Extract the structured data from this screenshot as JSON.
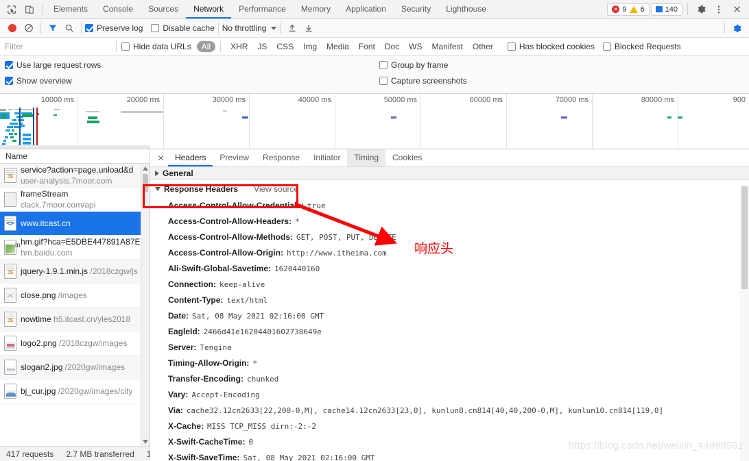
{
  "topbar": {
    "icons": [
      "inspect-element-icon",
      "device-toolbar-icon"
    ],
    "tabs": [
      {
        "label": "Elements",
        "active": false
      },
      {
        "label": "Console",
        "active": false
      },
      {
        "label": "Sources",
        "active": false
      },
      {
        "label": "Network",
        "active": true
      },
      {
        "label": "Performance",
        "active": false
      },
      {
        "label": "Memory",
        "active": false
      },
      {
        "label": "Application",
        "active": false
      },
      {
        "label": "Security",
        "active": false
      },
      {
        "label": "Lighthouse",
        "active": false
      }
    ],
    "error_count": "9",
    "warning_count": "6",
    "message_count": "140",
    "error_glyph": "×"
  },
  "network_toolbar": {
    "record_title": "record-button",
    "clear_title": "clear-button",
    "filter_title": "filter-button",
    "search_title": "search-button",
    "preserve_log": {
      "label": "Preserve log",
      "checked": true
    },
    "disable_cache": {
      "label": "Disable cache",
      "checked": false
    },
    "throttling": "No throttling",
    "import_title": "import-har-button",
    "export_title": "export-har-button"
  },
  "filter_bar": {
    "placeholder": "Filter",
    "value": "",
    "hide_data_urls": {
      "label": "Hide data URLs",
      "checked": false
    },
    "types": [
      {
        "label": "All",
        "active": true
      },
      {
        "label": "XHR",
        "active": false
      },
      {
        "label": "JS",
        "active": false
      },
      {
        "label": "CSS",
        "active": false
      },
      {
        "label": "Img",
        "active": false
      },
      {
        "label": "Media",
        "active": false
      },
      {
        "label": "Font",
        "active": false
      },
      {
        "label": "Doc",
        "active": false
      },
      {
        "label": "WS",
        "active": false
      },
      {
        "label": "Manifest",
        "active": false
      },
      {
        "label": "Other",
        "active": false
      }
    ],
    "has_blocked_cookies": {
      "label": "Has blocked cookies",
      "checked": false
    },
    "blocked_requests": {
      "label": "Blocked Requests",
      "checked": false
    }
  },
  "options": {
    "use_large_request_rows": {
      "label": "Use large request rows",
      "checked": true
    },
    "show_overview": {
      "label": "Show overview",
      "checked": true
    },
    "group_by_frame": {
      "label": "Group by frame",
      "checked": false
    },
    "capture_screenshots": {
      "label": "Capture screenshots",
      "checked": false
    }
  },
  "overview": {
    "tick_labels": [
      "10000 ms",
      "20000 ms",
      "30000 ms",
      "40000 ms",
      "50000 ms",
      "60000 ms",
      "70000 ms",
      "80000 ms",
      "900"
    ],
    "tick_x": [
      113,
      238,
      363,
      488,
      613,
      738,
      863,
      988,
      1085
    ],
    "dom_content_loaded_color": "#0b4ea2",
    "load_event_color": "#b31412",
    "request_color": "#1f9ce8",
    "finish_color": "#1aa260"
  },
  "requests_pane": {
    "column_header": "Name",
    "rows": [
      {
        "name": "service?action=page.unload&d",
        "sub": "user-analysis.7moor.com",
        "icon": "js-file-icon",
        "selected": false
      },
      {
        "name": "frameStream",
        "sub": "clack.7moor.com/api",
        "icon": "doc-file-icon",
        "selected": false
      },
      {
        "name": "www.itcast.cn",
        "sub": "",
        "icon": "html-file-icon",
        "selected": true
      },
      {
        "name": "hm.gif?hca=E5DBE447891A87E",
        "sub": "hm.baidu.com",
        "icon": "image-file-icon",
        "selected": false
      },
      {
        "name": "jquery-1.9.1.min.js",
        "sub": "/2018czgw/js",
        "icon": "js-file-icon",
        "selected": false
      },
      {
        "name": "close.png",
        "sub": "/images",
        "icon": "broken-image-icon",
        "selected": false
      },
      {
        "name": "nowtime",
        "sub": "h5.itcast.cn/yles2018",
        "icon": "js-file-icon",
        "selected": false
      },
      {
        "name": "logo2.png",
        "sub": "/2018czgw/images",
        "icon": "image-file-icon",
        "selected": false
      },
      {
        "name": "slogan2.jpg",
        "sub": "/2020gw/images",
        "icon": "image-file-icon",
        "selected": false
      },
      {
        "name": "bj_cur.jpg",
        "sub": "/2020gw/images/city",
        "icon": "image-file-icon",
        "selected": false
      }
    ]
  },
  "status_bar": {
    "requests": "417 requests",
    "transferred": "2.7 MB transferred",
    "resources": "1"
  },
  "detail": {
    "tabs": [
      {
        "label": "Headers",
        "active": true
      },
      {
        "label": "Preview",
        "active": false
      },
      {
        "label": "Response",
        "active": false
      },
      {
        "label": "Initiator",
        "active": false
      },
      {
        "label": "Timing",
        "active": false,
        "hover": true
      },
      {
        "label": "Cookies",
        "active": false
      }
    ],
    "general_section": {
      "title": "General",
      "expanded": false
    },
    "response_headers_section": {
      "title": "Response Headers",
      "view_source": "View source",
      "expanded": true
    },
    "headers": [
      {
        "key": "Access-Control-Allow-Credentials:",
        "value": "true"
      },
      {
        "key": "Access-Control-Allow-Headers:",
        "value": "*"
      },
      {
        "key": "Access-Control-Allow-Methods:",
        "value": "GET, POST, PUT, DELETE"
      },
      {
        "key": "Access-Control-Allow-Origin:",
        "value": "http://www.itheima.com"
      },
      {
        "key": "Ali-Swift-Global-Savetime:",
        "value": "1620440160"
      },
      {
        "key": "Connection:",
        "value": "keep-alive"
      },
      {
        "key": "Content-Type:",
        "value": "text/html"
      },
      {
        "key": "Date:",
        "value": "Sat, 08 May 2021 02:16:00 GMT"
      },
      {
        "key": "EagleId:",
        "value": "2466d41e16204401602738649e"
      },
      {
        "key": "Server:",
        "value": "Tengine"
      },
      {
        "key": "Timing-Allow-Origin:",
        "value": "*"
      },
      {
        "key": "Transfer-Encoding:",
        "value": "chunked"
      },
      {
        "key": "Vary:",
        "value": "Accept-Encoding"
      },
      {
        "key": "Via:",
        "value": "cache32.12cn2633[22,200-0,M], cache14.12cn2633[23,0], kunlun8.cn814[40,40,200-0,M], kunlun10.cn814[119,0]"
      },
      {
        "key": "X-Cache:",
        "value": "MISS TCP_MISS dirn:-2:-2"
      },
      {
        "key": "X-Swift-CacheTime:",
        "value": "0"
      },
      {
        "key": "X-Swift-SaveTime:",
        "value": "Sat, 08 May 2021 02:16:00 GMT"
      }
    ]
  },
  "annotations": {
    "label_text": "响应头",
    "color": "#ff0000"
  },
  "watermark": {
    "text": "https://blog.csdn.net/weixin_44999591"
  }
}
